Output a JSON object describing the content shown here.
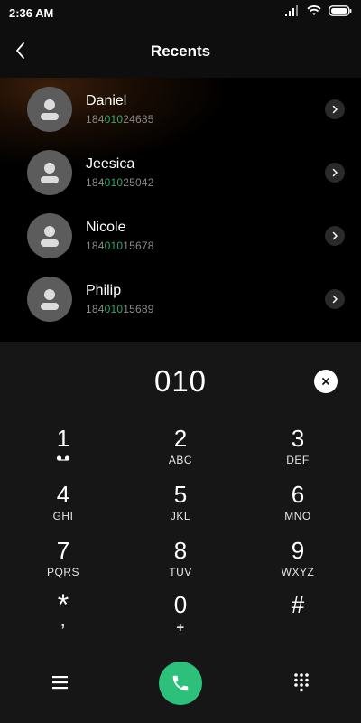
{
  "status_bar": {
    "time": "2:36 AM"
  },
  "header": {
    "title": "Recents"
  },
  "recents": [
    {
      "name": "Daniel",
      "number_prefix": "184",
      "number_match": "010",
      "number_suffix": "24685"
    },
    {
      "name": "Jeesica",
      "number_prefix": "184",
      "number_match": "010",
      "number_suffix": "25042"
    },
    {
      "name": "Nicole",
      "number_prefix": "184",
      "number_match": "010",
      "number_suffix": "15678"
    },
    {
      "name": "Philip",
      "number_prefix": "184",
      "number_match": "010",
      "number_suffix": "15689"
    }
  ],
  "dialer": {
    "display": "010",
    "keys": [
      {
        "digit": "1",
        "letters": ""
      },
      {
        "digit": "2",
        "letters": "ABC"
      },
      {
        "digit": "3",
        "letters": "DEF"
      },
      {
        "digit": "4",
        "letters": "GHI"
      },
      {
        "digit": "5",
        "letters": "JKL"
      },
      {
        "digit": "6",
        "letters": "MNO"
      },
      {
        "digit": "7",
        "letters": "PQRS"
      },
      {
        "digit": "8",
        "letters": "TUV"
      },
      {
        "digit": "9",
        "letters": "WXYZ"
      },
      {
        "digit": "*",
        "letters": ","
      },
      {
        "digit": "0",
        "letters": "+"
      },
      {
        "digit": "#",
        "letters": ""
      }
    ]
  },
  "colors": {
    "accent_green": "#2dc07a",
    "match_green": "#2fa66a",
    "avatar_gray": "#5c5c5c"
  },
  "icons": {
    "back": "chevron-left-icon",
    "contact": "person-icon",
    "detail": "chevron-right-icon",
    "clear": "close-icon",
    "voicemail": "voicemail-icon",
    "menu": "menu-icon",
    "call": "phone-icon",
    "keypad": "dialpad-icon"
  }
}
